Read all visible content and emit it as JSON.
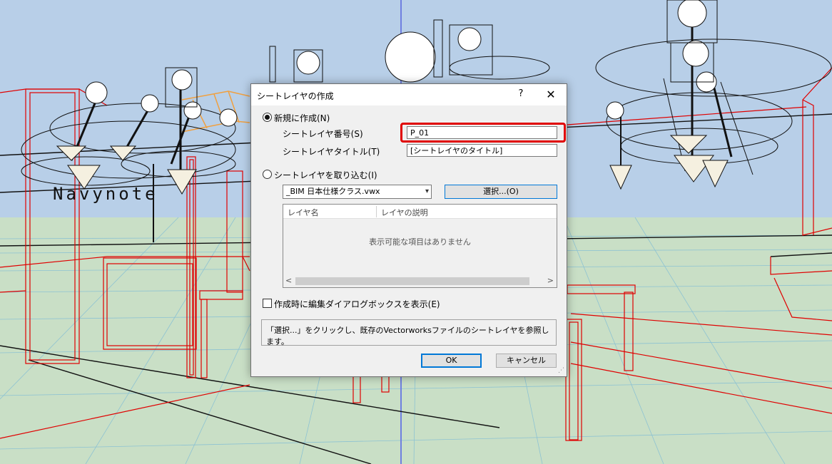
{
  "viewport": {
    "brand_text": "Navynote"
  },
  "dialog": {
    "title": "シートレイヤの作成",
    "help_label": "?",
    "close_label": "✕",
    "new_option_label": "新規に作成(N)",
    "number_label": "シートレイヤ番号(S)",
    "number_value": "P_01",
    "title_field_label": "シートレイヤタイトル(T)",
    "title_field_value": "[シートレイヤのタイトル]",
    "import_option_label": "シートレイヤを取り込む(I)",
    "file_select_value": "_BIM 日本仕様クラス.vwx",
    "select_button_label": "選択...(O)",
    "list": {
      "columns": [
        "レイヤ名",
        "レイヤの説明"
      ],
      "empty_message": "表示可能な項目はありません"
    },
    "show_edit_dialog_label": "作成時に編集ダイアログボックスを表示(E)",
    "info_text": "「選択...」をクリックし、既存のVectorworksファイルのシートレイヤを参照します。",
    "ok_label": "OK",
    "cancel_label": "キャンセル"
  },
  "icons": {
    "help": "help-icon",
    "close": "close-icon",
    "dropdown": "chevron-down-icon",
    "scroll_left": "chevron-left-icon",
    "scroll_right": "chevron-right-icon",
    "resize": "resize-grip-icon"
  },
  "colors": {
    "highlight": "#e00000",
    "accent": "#0078d7",
    "sky": "#b8cfe8",
    "ground": "#c9dfc6",
    "wireframe": "#e00000"
  }
}
